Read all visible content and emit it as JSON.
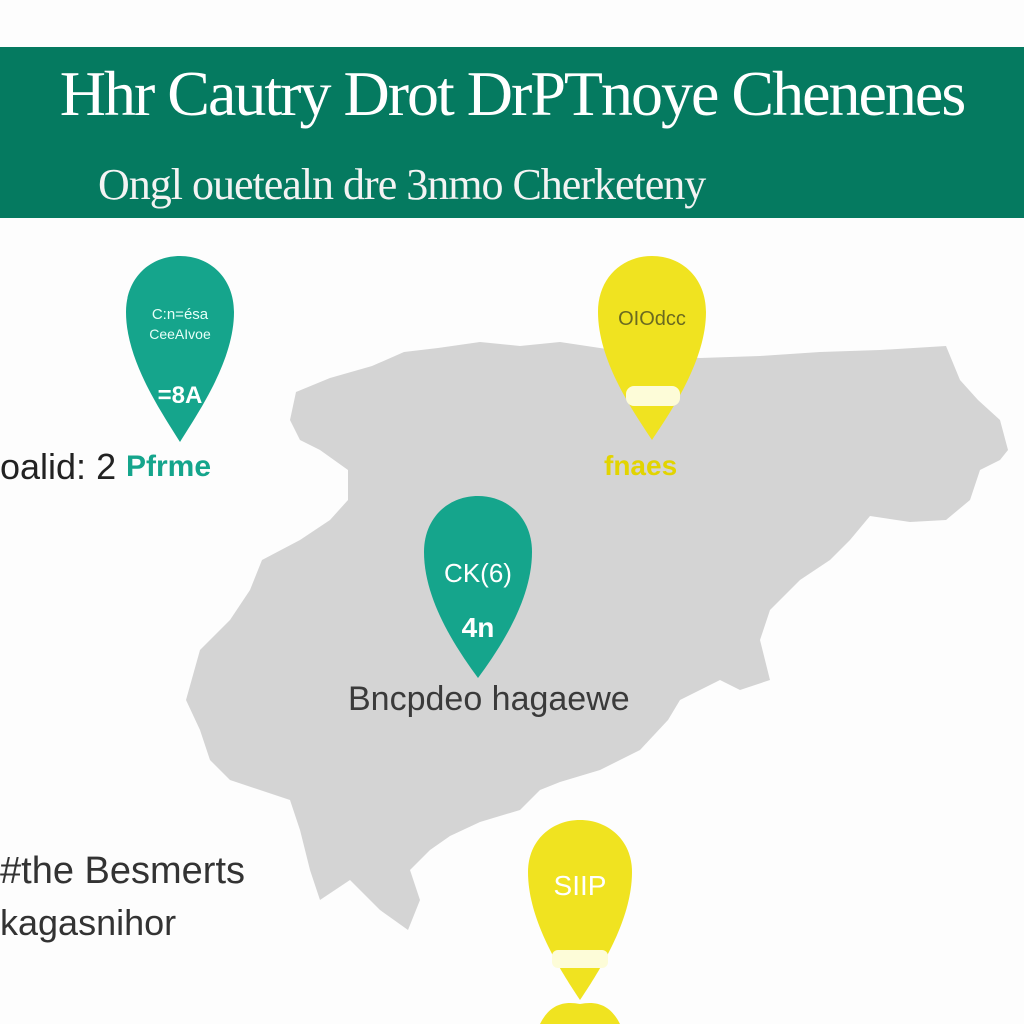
{
  "banner": {
    "title": "Hhr Cautry Drot DrPTnoye Chenenes",
    "subtitle": "Ongl ouetealn dre 3nmo Cherketeny",
    "color": "#057a60"
  },
  "map": {
    "region_color": "#d4d4d4"
  },
  "pins": [
    {
      "color": "#15a58c",
      "icon": "map-pin-teal",
      "top_text": "C:n=ésa",
      "mid_text": "CeeAIvoe",
      "bottom_text": "=8A",
      "caption": "Pfrme"
    },
    {
      "color": "#f0e320",
      "icon": "map-pin-yellow",
      "top_text": "OIOdcc",
      "mid_text": "",
      "bottom_text": "",
      "caption": "fnaes"
    },
    {
      "color": "#15a58c",
      "icon": "map-pin-teal",
      "top_text": "CK(6)",
      "mid_text": "",
      "bottom_text": "4n",
      "caption": ""
    },
    {
      "color": "#f0e320",
      "icon": "map-pin-yellow",
      "top_text": "SIIP",
      "mid_text": "",
      "bottom_text": "",
      "caption": ""
    }
  ],
  "labels": {
    "left_label": "oalid: 2",
    "center_label": "Bncpdeo hagaewe",
    "bottom_line1": "#the Besmerts",
    "bottom_line2": "kagasnihor"
  }
}
